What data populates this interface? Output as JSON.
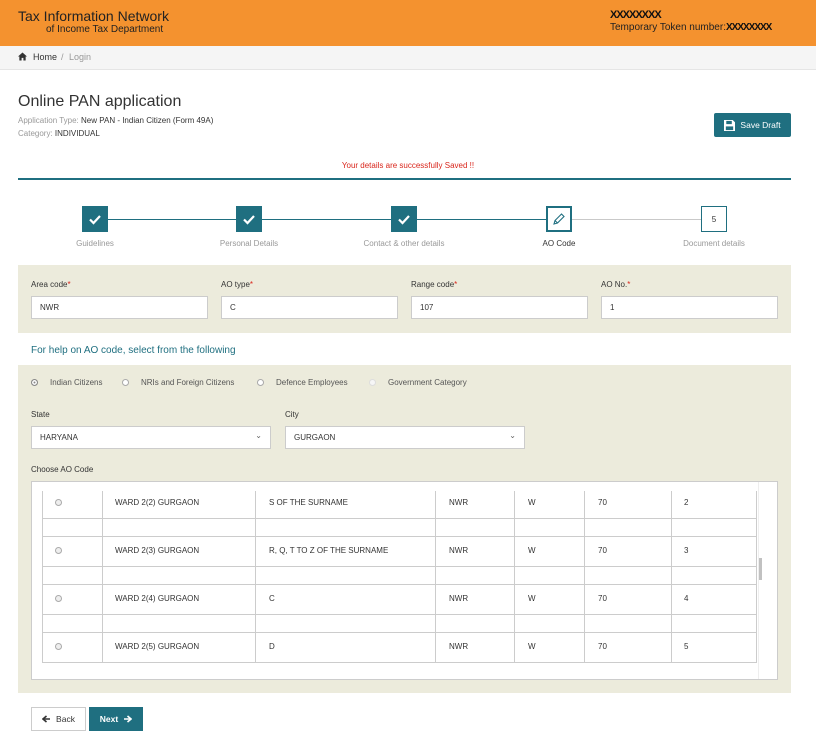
{
  "header": {
    "brand_line1": "Tax Information Network",
    "brand_line2": "of Income Tax Department",
    "token_scribble": "XXXXXXXX",
    "token_label": "Temporary Token number:",
    "token_value": "XXXXXXXX",
    "color": "#f4922f"
  },
  "breadcrumb": {
    "home": "Home",
    "sep": "/",
    "current": "Login",
    "icon": "home-icon"
  },
  "page": {
    "title": "Online PAN application",
    "app_type_label": "Application Type:",
    "app_type_value": "New PAN - Indian Citizen (Form 49A)",
    "category_label": "Category:",
    "category_value": "INDIVIDUAL",
    "save_draft": "Save Draft",
    "save_icon": "floppy-disk-icon",
    "saved_message": "Your details are successfully Saved !!",
    "accent": "#1f6f80",
    "alert_color": "#d9261c"
  },
  "steps": [
    {
      "label": "Guidelines",
      "status": "done"
    },
    {
      "label": "Personal Details",
      "status": "done"
    },
    {
      "label": "Contact & other details",
      "status": "done"
    },
    {
      "label": "AO Code",
      "status": "current"
    },
    {
      "label": "Document details",
      "status": "todo",
      "number": "5"
    }
  ],
  "fields": [
    {
      "label": "Area code",
      "value": "NWR"
    },
    {
      "label": "AO type",
      "value": "C"
    },
    {
      "label": "Range code",
      "value": "107"
    },
    {
      "label": "AO No.",
      "value": "1"
    }
  ],
  "help_text": "For help on AO code, select from the following",
  "radios": [
    {
      "label": "Indian Citizens",
      "selected": true
    },
    {
      "label": "NRIs and Foreign Citizens",
      "selected": false
    },
    {
      "label": "Defence Employees",
      "selected": false
    },
    {
      "label": "Government Category",
      "selected": false,
      "disabled": true
    }
  ],
  "state": {
    "label": "State",
    "value": "HARYANA"
  },
  "city": {
    "label": "City",
    "value": "GURGAON"
  },
  "choose_ao_label": "Choose AO Code",
  "ao_rows": [
    {
      "ward": "WARD 2(2) GURGAON",
      "desc": "S OF THE SURNAME",
      "area": "NWR",
      "type": "W",
      "range": "70",
      "no": "2"
    },
    {
      "ward": "WARD 2(3) GURGAON",
      "desc": "R, Q, T TO Z OF THE SURNAME",
      "area": "NWR",
      "type": "W",
      "range": "70",
      "no": "3"
    },
    {
      "ward": "WARD 2(4) GURGAON",
      "desc": "C",
      "area": "NWR",
      "type": "W",
      "range": "70",
      "no": "4"
    },
    {
      "ward": "WARD 2(5) GURGAON",
      "desc": "D",
      "area": "NWR",
      "type": "W",
      "range": "70",
      "no": "5"
    }
  ],
  "nav": {
    "back": "Back",
    "next": "Next"
  }
}
